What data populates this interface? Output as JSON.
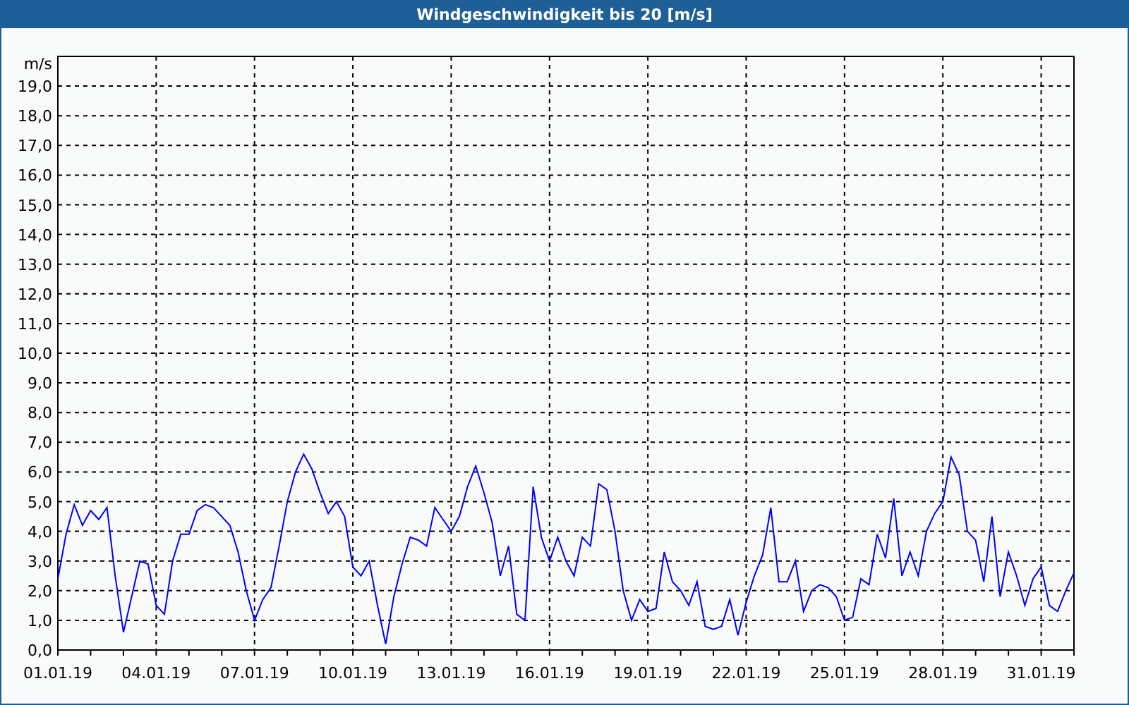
{
  "window": {
    "title": "Windgeschwindigkeit bis 20 [m/s]"
  },
  "chart": {
    "chart_data": {
      "type": "line",
      "grid": true,
      "ylabel": "m/s",
      "ylim": [
        0,
        20
      ],
      "yticks": [
        {
          "value": 0,
          "label": "0,0"
        },
        {
          "value": 1,
          "label": "1,0"
        },
        {
          "value": 2,
          "label": "2,0"
        },
        {
          "value": 3,
          "label": "3,0"
        },
        {
          "value": 4,
          "label": "4,0"
        },
        {
          "value": 5,
          "label": "5,0"
        },
        {
          "value": 6,
          "label": "6,0"
        },
        {
          "value": 7,
          "label": "7,0"
        },
        {
          "value": 8,
          "label": "8,0"
        },
        {
          "value": 9,
          "label": "9,0"
        },
        {
          "value": 10,
          "label": "10,0"
        },
        {
          "value": 11,
          "label": "11,0"
        },
        {
          "value": 12,
          "label": "12,0"
        },
        {
          "value": 13,
          "label": "13,0"
        },
        {
          "value": 14,
          "label": "14,0"
        },
        {
          "value": 15,
          "label": "15,0"
        },
        {
          "value": 16,
          "label": "16,0"
        },
        {
          "value": 17,
          "label": "17,0"
        },
        {
          "value": 18,
          "label": "18,0"
        },
        {
          "value": 19,
          "label": "19,0"
        }
      ],
      "categories": [
        "01.01.19",
        null,
        null,
        null,
        null,
        null,
        null,
        null,
        null,
        null,
        null,
        null,
        "04.01.19",
        null,
        null,
        null,
        null,
        null,
        null,
        null,
        null,
        null,
        null,
        null,
        "07.01.19",
        null,
        null,
        null,
        null,
        null,
        null,
        null,
        null,
        null,
        null,
        null,
        "10.01.19",
        null,
        null,
        null,
        null,
        null,
        null,
        null,
        null,
        null,
        null,
        null,
        "13.01.19",
        null,
        null,
        null,
        null,
        null,
        null,
        null,
        null,
        null,
        null,
        null,
        "16.01.19",
        null,
        null,
        null,
        null,
        null,
        null,
        null,
        null,
        null,
        null,
        null,
        "19.01.19",
        null,
        null,
        null,
        null,
        null,
        null,
        null,
        null,
        null,
        null,
        null,
        "22.01.19",
        null,
        null,
        null,
        null,
        null,
        null,
        null,
        null,
        null,
        null,
        null,
        "25.01.19",
        null,
        null,
        null,
        null,
        null,
        null,
        null,
        null,
        null,
        null,
        null,
        "28.01.19",
        null,
        null,
        null,
        null,
        null,
        null,
        null,
        null,
        null,
        null,
        null,
        "31.01.19",
        null,
        null,
        null,
        null
      ],
      "series": [
        {
          "color": "#0000ff",
          "values": [
            2.4,
            3.9,
            4.9,
            4.2,
            4.7,
            4.4,
            4.8,
            2.5,
            0.6,
            1.8,
            3.0,
            2.9,
            1.5,
            1.2,
            3.0,
            3.9,
            3.9,
            4.7,
            4.9,
            4.8,
            4.5,
            4.2,
            3.3,
            2.0,
            1.0,
            1.7,
            2.1,
            3.5,
            5.0,
            6.0,
            6.6,
            6.1,
            5.3,
            4.6,
            5.0,
            4.5,
            2.8,
            2.5,
            3.0,
            1.5,
            0.2,
            1.8,
            2.9,
            3.8,
            3.7,
            3.5,
            4.8,
            4.4,
            4.0,
            4.5,
            5.5,
            6.2,
            5.3,
            4.3,
            2.5,
            3.5,
            1.2,
            1.0,
            5.5,
            3.8,
            3.0,
            3.8,
            3.0,
            2.5,
            3.8,
            3.5,
            5.6,
            5.4,
            4.0,
            2.0,
            1.0,
            1.7,
            1.3,
            1.4,
            3.3,
            2.3,
            2.0,
            1.5,
            2.3,
            0.8,
            0.7,
            0.8,
            1.7,
            0.5,
            1.6,
            2.5,
            3.2,
            4.8,
            2.3,
            2.3,
            3.0,
            1.3,
            2.0,
            2.2,
            2.1,
            1.8,
            1.0,
            1.1,
            2.4,
            2.2,
            3.9,
            3.1,
            5.1,
            2.5,
            3.3,
            2.5,
            4.0,
            4.6,
            5.0,
            6.5,
            5.9,
            4.0,
            3.7,
            2.3,
            4.5,
            1.8,
            3.3,
            2.5,
            1.5,
            2.4,
            2.8,
            1.5,
            1.3,
            2.0,
            2.6
          ]
        }
      ]
    }
  }
}
